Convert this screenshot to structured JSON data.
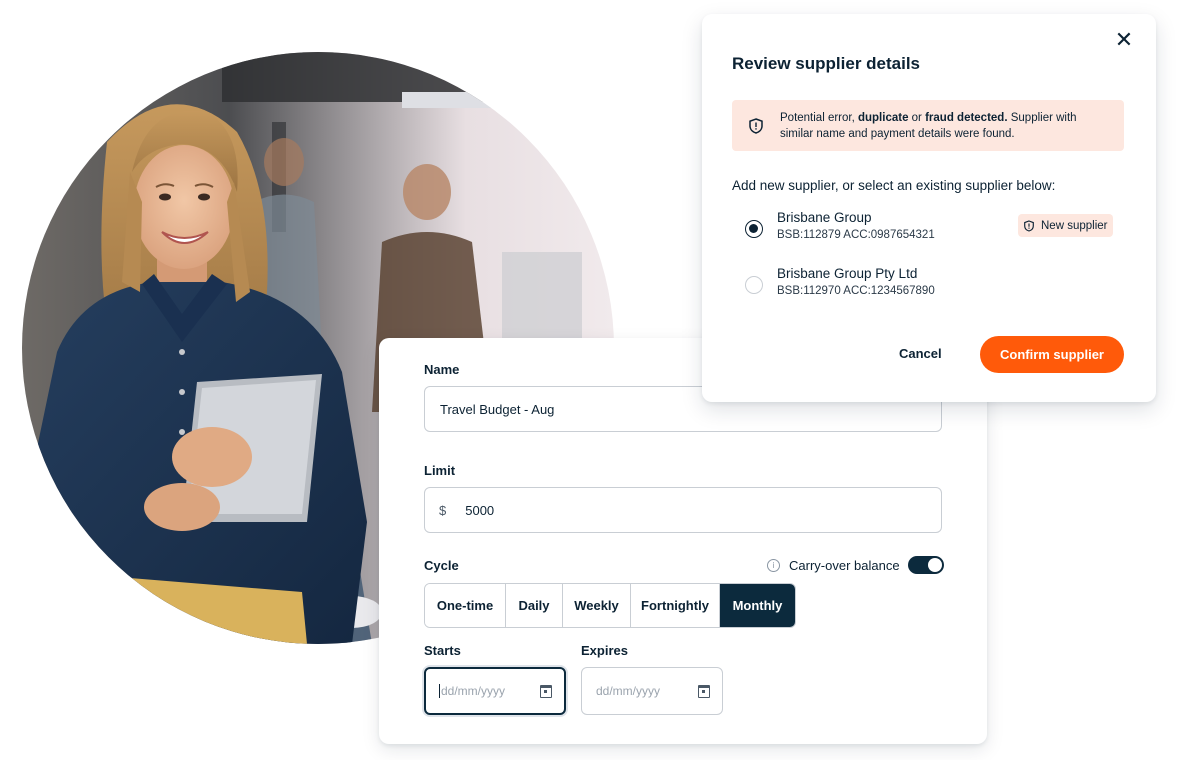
{
  "photo": {
    "description_icon": "person-photo"
  },
  "form": {
    "name_label": "Name",
    "name_value": "Travel Budget - Aug",
    "limit_label": "Limit",
    "currency_symbol": "$",
    "limit_value": "5000",
    "cycle_label": "Cycle",
    "carry_over_label": "Carry-over balance",
    "carry_over_enabled": true,
    "cycle_options": [
      {
        "label": "One-time",
        "active": false
      },
      {
        "label": "Daily",
        "active": false
      },
      {
        "label": "Weekly",
        "active": false
      },
      {
        "label": "Fortnightly",
        "active": false
      },
      {
        "label": "Monthly",
        "active": true
      }
    ],
    "starts_label": "Starts",
    "starts_placeholder": "dd/mm/yyyy",
    "expires_label": "Expires",
    "expires_placeholder": "dd/mm/yyyy"
  },
  "modal": {
    "title": "Review supplier details",
    "alert_lead": "Potential error, ",
    "alert_emphasis": "duplicate",
    "alert_mid": " or ",
    "alert_emphasis2": "fraud detected.",
    "alert_rest": " Supplier with similar name and payment details were found.",
    "prompt": "Add new supplier, or select an existing supplier below:",
    "options": [
      {
        "name": "Brisbane Group",
        "detail": "BSB:112879 ACC:0987654321",
        "selected": true
      },
      {
        "name": "Brisbane Group Pty Ltd",
        "detail": "BSB:112970 ACC:1234567890",
        "selected": false
      }
    ],
    "new_badge": "New supplier",
    "cancel_label": "Cancel",
    "confirm_label": "Confirm supplier",
    "close_glyph": "✕"
  },
  "colors": {
    "accent": "#ff5a0a",
    "navy": "#0c2a3d",
    "alert_bg": "#fde7df"
  }
}
